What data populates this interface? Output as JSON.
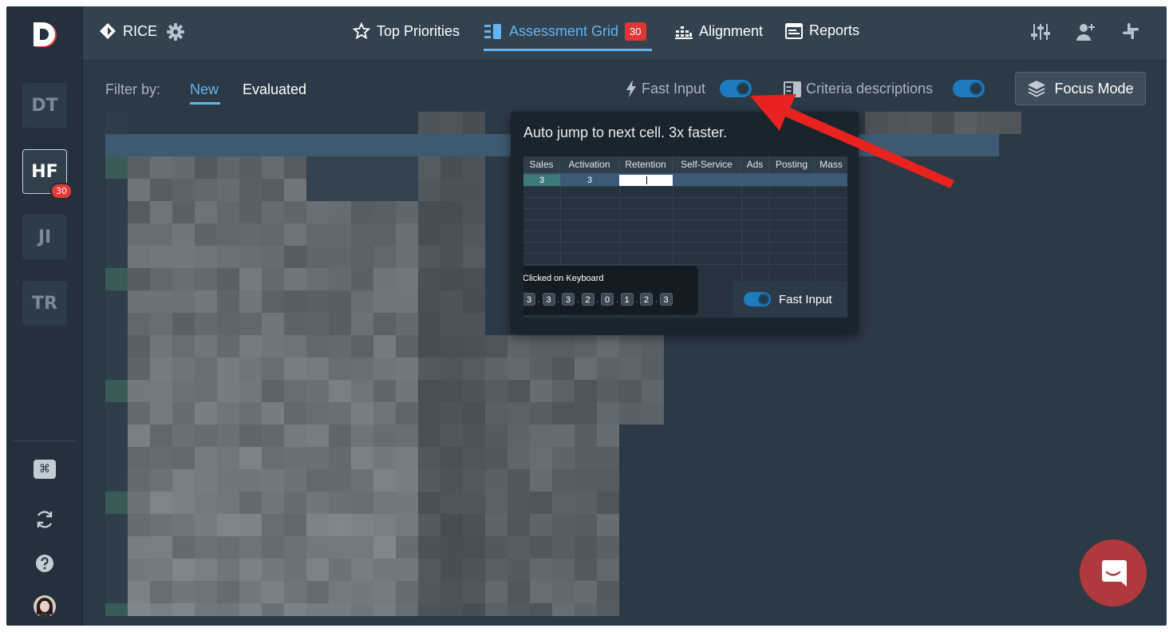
{
  "rail": {
    "workspaces": [
      {
        "label": "DT",
        "active": false
      },
      {
        "label": "HF",
        "active": true,
        "badge": "30"
      },
      {
        "label": "JI",
        "active": false
      },
      {
        "label": "TR",
        "active": false
      }
    ],
    "shortcut_glyph": "⌘"
  },
  "topbar": {
    "app_name": "RICE",
    "tabs": [
      {
        "label": "Top Priorities",
        "icon": "star-outline-icon"
      },
      {
        "label": "Assessment Grid",
        "icon": "grid-list-icon",
        "badge": "30",
        "active": true
      },
      {
        "label": "Alignment",
        "icon": "bar-chart-icon"
      },
      {
        "label": "Reports",
        "icon": "report-window-icon"
      }
    ],
    "right_icons": [
      "sliders-icon",
      "add-user-icon",
      "slack-icon"
    ]
  },
  "filterbar": {
    "label": "Filter by:",
    "filters": [
      {
        "label": "New",
        "active": true
      },
      {
        "label": "Evaluated",
        "active": false
      }
    ],
    "fast_input_label": "Fast Input",
    "fast_input_on": true,
    "criteria_label": "Criteria descriptions",
    "criteria_on": true,
    "focus_mode_label": "Focus Mode"
  },
  "popover": {
    "title": "Auto jump to next cell. 3x faster.",
    "columns": [
      "Sales",
      "Activation",
      "Retention",
      "Self-Service",
      "Ads",
      "Posting",
      "Mass"
    ],
    "row_values": [
      "3",
      "3"
    ],
    "keyboard_title": "Clicked on Keyboard",
    "keys": [
      "3",
      "3",
      "3",
      "2",
      "0",
      "1",
      "2",
      "3"
    ],
    "key_separator": ",",
    "fast_input_label": "Fast Input"
  },
  "colors": {
    "accent": "#63b4f0",
    "badge": "#e03636",
    "arrow": "#e8231f",
    "chat": "#b0393e"
  }
}
